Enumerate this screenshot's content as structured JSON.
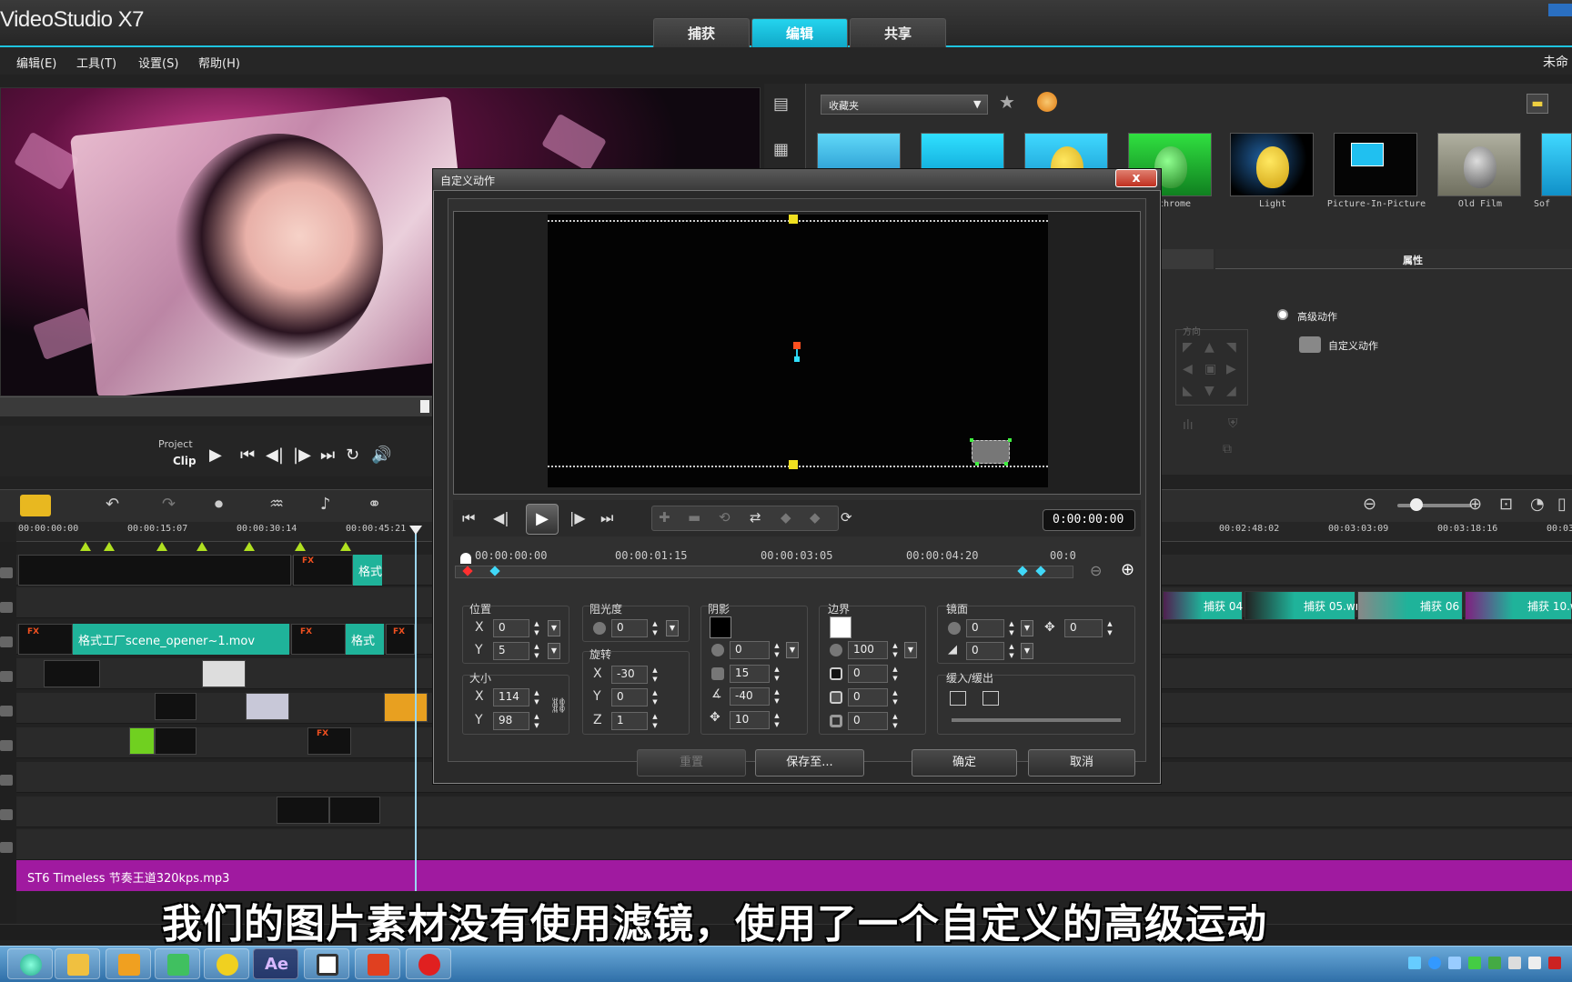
{
  "app": {
    "title": "VideoStudio X7",
    "title_right": "未命",
    "tabs": [
      {
        "label": "捕获"
      },
      {
        "label": "编辑"
      },
      {
        "label": "共享"
      }
    ],
    "active_tab": "编辑"
  },
  "menu": {
    "items": [
      {
        "label": "编辑(E)"
      },
      {
        "label": "工具(T)"
      },
      {
        "label": "设置(S)"
      },
      {
        "label": "帮助(H)"
      }
    ]
  },
  "player": {
    "project_label": "Project",
    "clip_label": "Clip"
  },
  "library": {
    "dropdown_value": "收藏夹",
    "thumbnails": [
      {
        "label": ""
      },
      {
        "label": ""
      },
      {
        "label": ""
      },
      {
        "label": "nochrome"
      },
      {
        "label": "Light"
      },
      {
        "label": "Picture-In-Picture"
      },
      {
        "label": "Old Film"
      },
      {
        "label": "Sof"
      }
    ]
  },
  "properties": {
    "header": "属性",
    "direction_label": "方向",
    "advanced_motion": "高级动作",
    "custom_motion": "自定义动作"
  },
  "timeline": {
    "ruler": [
      "00:00:00:00",
      "00:00:15:07",
      "00:00:30:14",
      "00:00:45:21",
      "00:02:48:02",
      "00:03:03:09",
      "00:03:18:16",
      "00:03"
    ],
    "clips": {
      "overlay1_label": "格式",
      "main_clip_label": "格式工厂scene_opener~1.mov",
      "main_clip2_label": "格式",
      "capture_clips": [
        "捕获 04",
        "捕获 05.wr",
        "捕获 06",
        "捕获 10.w"
      ],
      "music_label": "ST6 Timeless 节奏王道320kps.mp3"
    },
    "fx_label": "FX"
  },
  "subtitle": "我们的图片素材没有使用滤镜，使用了一个自定义的高级运动",
  "dialog": {
    "title": "自定义动作",
    "close_label": "x",
    "timecode": "0:00:00:00",
    "ruler": [
      "00:00:00:00",
      "00:00:01:15",
      "00:00:03:05",
      "00:00:04:20",
      "00:0"
    ],
    "position": {
      "title": "位置",
      "x_label": "X",
      "x": "0",
      "y_label": "Y",
      "y": "5"
    },
    "size": {
      "title": "大小",
      "x_label": "X",
      "x": "114",
      "y_label": "Y",
      "y": "98"
    },
    "opacity": {
      "title": "阻光度",
      "value": "0"
    },
    "rotation": {
      "title": "旋转",
      "x_label": "X",
      "x": "-30",
      "y_label": "Y",
      "y": "0",
      "z_label": "Z",
      "z": "1"
    },
    "shadow": {
      "title": "阴影",
      "v1": "0",
      "v2": "15",
      "v3": "-40",
      "v4": "10",
      "color": "#000000"
    },
    "border": {
      "title": "边界",
      "v1": "100",
      "v2": "0",
      "v3": "0",
      "v4": "0",
      "color": "#ffffff"
    },
    "mirror": {
      "title": "镜面",
      "v1": "0",
      "v2": "0",
      "v3": "0"
    },
    "ease": {
      "title": "缓入/缓出"
    },
    "buttons": {
      "reset": "重置",
      "save_to": "保存至...",
      "ok": "确定",
      "cancel": "取消"
    }
  },
  "colors": {
    "accent": "#1ec4e0",
    "clip_teal": "#1fb39a",
    "music_purple": "#a01aa0"
  }
}
